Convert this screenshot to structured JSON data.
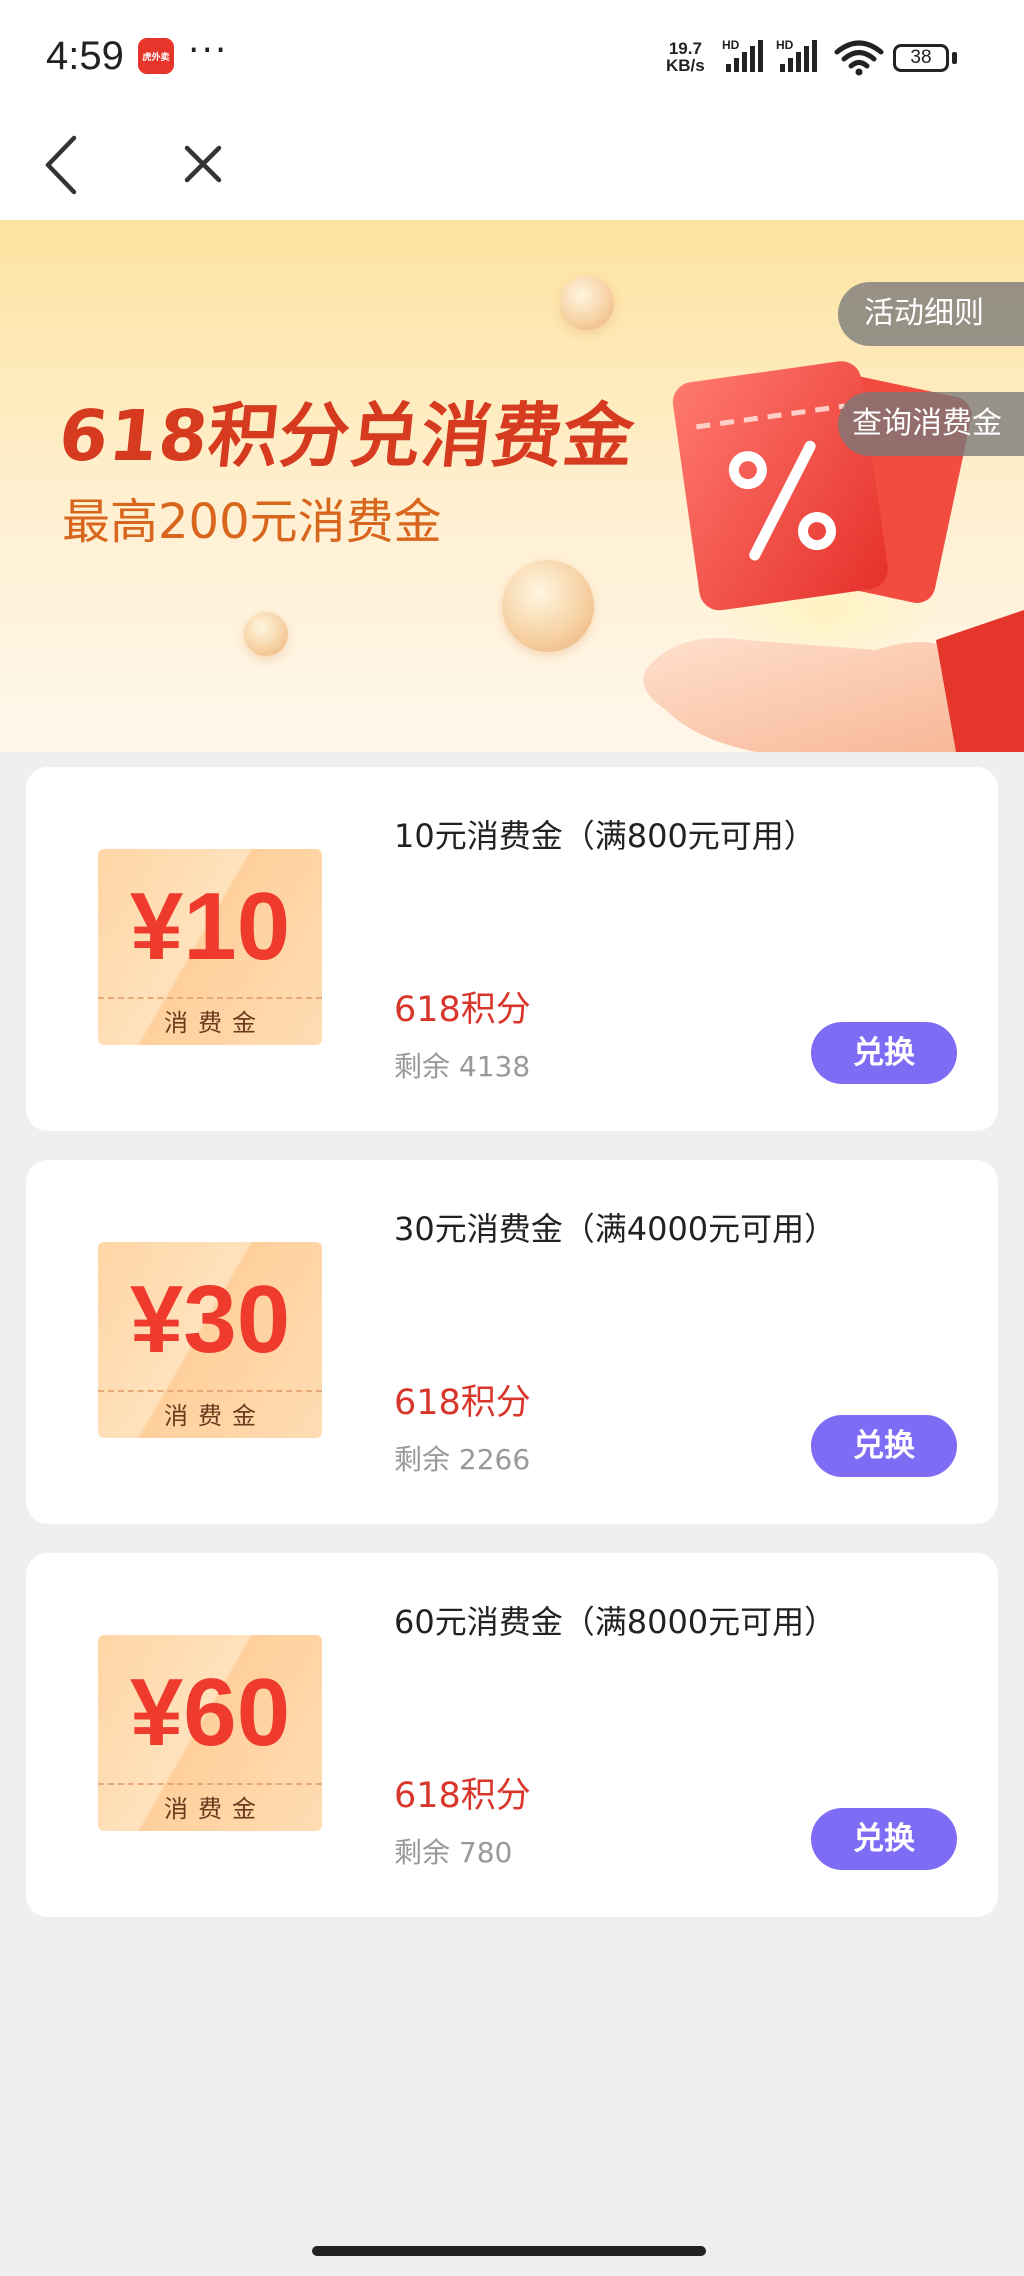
{
  "status_bar": {
    "time": "4:59",
    "app_badge": "虎外卖",
    "dots": "···",
    "net_speed_value": "19.7",
    "net_speed_unit": "KB/s",
    "hd_label": "HD",
    "battery": "38"
  },
  "banner": {
    "title": "618积分兑消费金",
    "subtitle": "最高200元消费金",
    "rules_button": "活动细则",
    "query_button": "查询消费金"
  },
  "coupons": [
    {
      "amount": "¥10",
      "label": "消费金",
      "title": "10元消费金（满800元可用）",
      "points": "618积分",
      "remain": "剩余 4138",
      "button": "兑换"
    },
    {
      "amount": "¥30",
      "label": "消费金",
      "title": "30元消费金（满4000元可用）",
      "points": "618积分",
      "remain": "剩余 2266",
      "button": "兑换"
    },
    {
      "amount": "¥60",
      "label": "消费金",
      "title": "60元消费金（满8000元可用）",
      "points": "618积分",
      "remain": "剩余 780",
      "button": "兑换"
    }
  ],
  "colors": {
    "accent": "#7e6cf4",
    "points": "#d8362b",
    "coupon_amount": "#ef3a2e",
    "page_bg": "#efefef"
  },
  "icons": {
    "back": "chevron-left-icon",
    "close": "close-icon"
  }
}
